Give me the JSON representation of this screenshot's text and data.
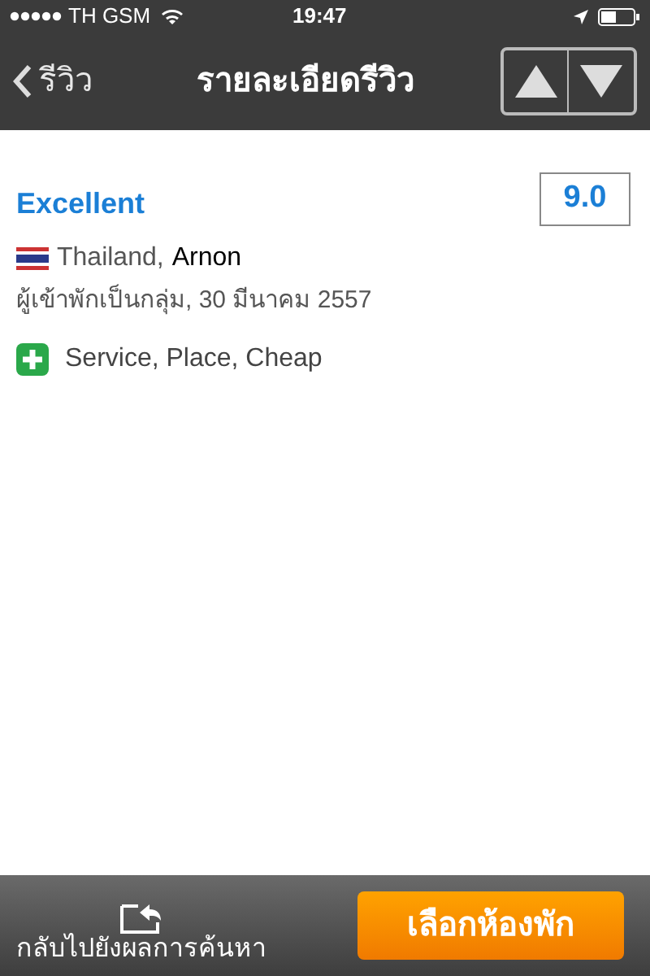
{
  "status_bar": {
    "carrier": "TH GSM",
    "time": "19:47"
  },
  "nav": {
    "back": "รีวิว",
    "title": "รายละเอียดรีวิว"
  },
  "review": {
    "rating_label": "Excellent",
    "score": "9.0",
    "country": "Thailand,",
    "name": "Arnon",
    "meta": "ผู้เข้าพักเป็นกลุ่ม, 30 มีนาคม 2557",
    "positives": "Service, Place, Cheap"
  },
  "bottom_bar": {
    "back_to_results": "กลับไปยังผลการค้นหา",
    "select_room": "เลือกห้องพัก"
  }
}
